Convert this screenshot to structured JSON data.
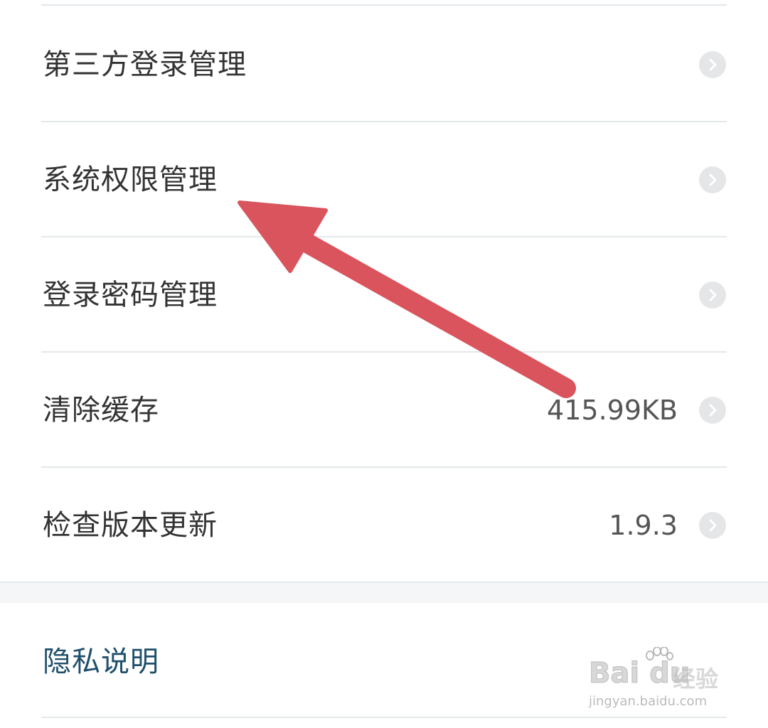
{
  "settings": {
    "items": [
      {
        "label": "第三方登录管理",
        "value": "",
        "icon": "chevron-right-icon"
      },
      {
        "label": "系统权限管理",
        "value": "",
        "icon": "chevron-right-icon"
      },
      {
        "label": "登录密码管理",
        "value": "",
        "icon": "chevron-right-icon"
      },
      {
        "label": "清除缓存",
        "value": "415.99KB",
        "icon": "chevron-right-icon"
      },
      {
        "label": "检查版本更新",
        "value": "1.9.3",
        "icon": "chevron-right-icon"
      }
    ],
    "privacy": {
      "label": "隐私说明"
    }
  },
  "annotation": {
    "arrow_color": "#d9545c",
    "arrow_target": "系统权限管理"
  },
  "watermark": {
    "brand": "Bai du",
    "brand_cn": "经验",
    "url": "jingyan.baidu.com"
  },
  "colors": {
    "text_primary": "#333333",
    "text_value": "#555555",
    "privacy_text": "#1f4f6b",
    "divider": "#e3e8ea",
    "chevron_bg": "#e4e6e7"
  }
}
